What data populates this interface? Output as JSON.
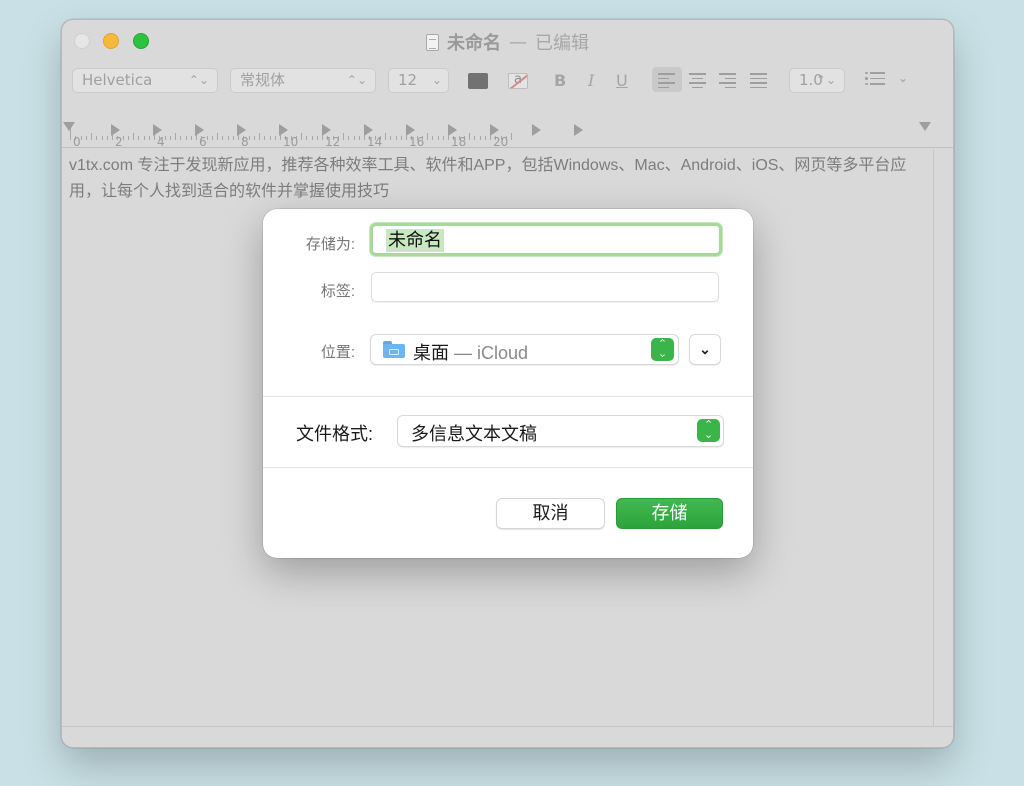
{
  "window": {
    "title": "未命名",
    "title_separator": "—",
    "title_state": "已编辑"
  },
  "toolbar": {
    "font_family": "Helvetica",
    "font_style": "常规体",
    "font_size": "12",
    "line_spacing": "1.0",
    "bold_label": "B",
    "italic_label": "I",
    "underline_label": "U",
    "highlight_glyph": "a",
    "updown_glyph": "⌃⌄",
    "chevron_glyph": "⌄"
  },
  "ruler": {
    "numbers": [
      "0",
      "2",
      "4",
      "6",
      "8",
      "10",
      "12",
      "14",
      "16",
      "18",
      "20"
    ]
  },
  "document": {
    "text": "v1tx.com 专注于发现新应用，推荐各种效率工具、软件和APP，包括Windows、Mac、Android、iOS、网页等多平台应用，让每个人找到适合的软件并掌握使用技巧"
  },
  "save_sheet": {
    "save_as_label": "存储为:",
    "filename_value": "未命名",
    "tags_label": "标签:",
    "tags_value": "",
    "where_label": "位置:",
    "where_value": "桌面",
    "where_sub": "— iCloud",
    "format_label": "文件格式:",
    "format_value": "多信息文本文稿",
    "expand_glyph": "⌄",
    "cancel_label": "取消",
    "save_label": "存储"
  },
  "colors": {
    "accent_green": "#39b54a",
    "background": "#c9e1e6"
  }
}
